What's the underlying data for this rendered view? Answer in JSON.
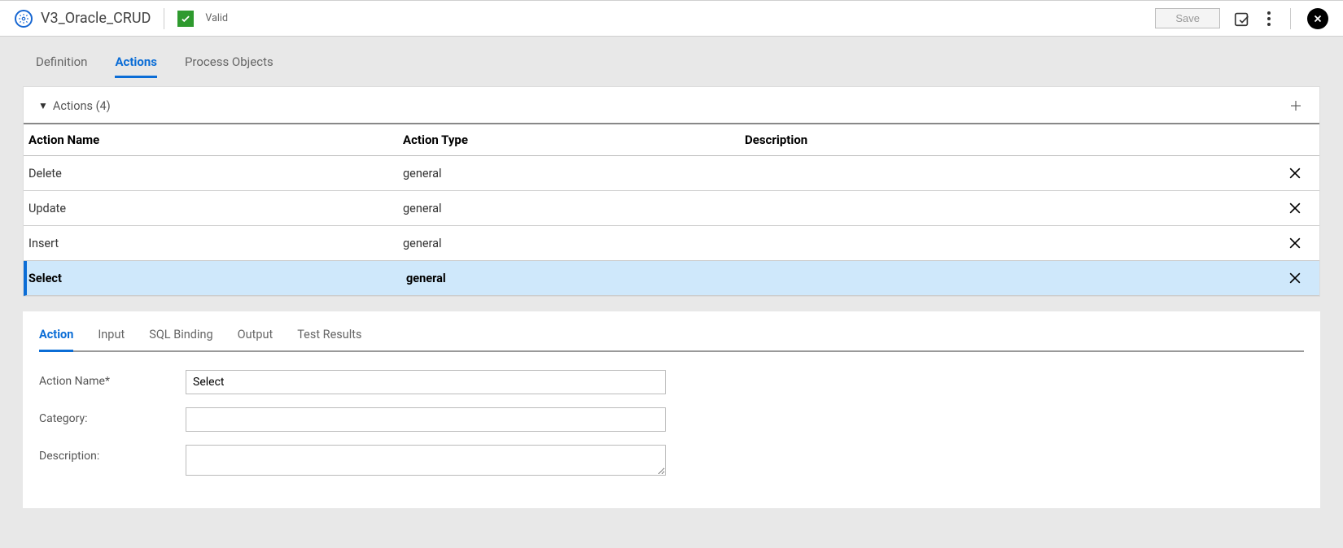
{
  "header": {
    "title": "V3_Oracle_CRUD",
    "valid_label": "Valid",
    "save_label": "Save"
  },
  "top_tabs": [
    {
      "label": "Definition",
      "active": false
    },
    {
      "label": "Actions",
      "active": true
    },
    {
      "label": "Process Objects",
      "active": false
    }
  ],
  "actions_section": {
    "header": "Actions (4)",
    "columns": {
      "name": "Action Name",
      "type": "Action Type",
      "desc": "Description"
    },
    "rows": [
      {
        "name": "Delete",
        "type": "general",
        "desc": "",
        "selected": false
      },
      {
        "name": "Update",
        "type": "general",
        "desc": "",
        "selected": false
      },
      {
        "name": "Insert",
        "type": "general",
        "desc": "",
        "selected": false
      },
      {
        "name": "Select",
        "type": "general",
        "desc": "",
        "selected": true
      }
    ]
  },
  "detail_tabs": [
    {
      "label": "Action",
      "active": true
    },
    {
      "label": "Input",
      "active": false
    },
    {
      "label": "SQL Binding",
      "active": false
    },
    {
      "label": "Output",
      "active": false
    },
    {
      "label": "Test Results",
      "active": false
    }
  ],
  "form": {
    "action_name_label": "Action Name*",
    "action_name_value": "Select",
    "category_label": "Category:",
    "category_value": "",
    "description_label": "Description:",
    "description_value": ""
  }
}
